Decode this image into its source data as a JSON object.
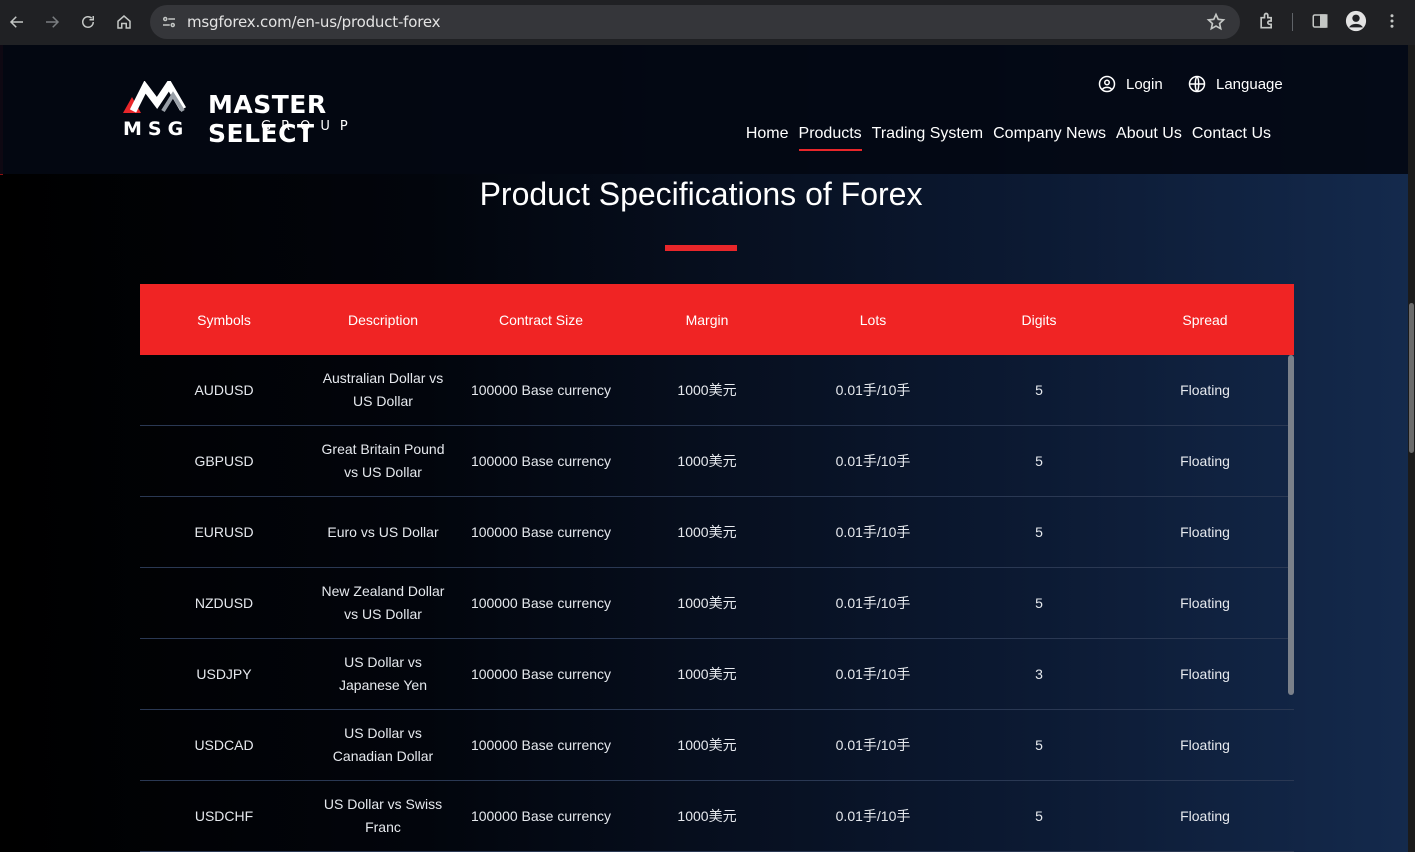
{
  "browser": {
    "url": "msgforex.com/en-us/product-forex"
  },
  "header": {
    "brand": "MASTER SELECT",
    "brand_sub": "GROUP",
    "brand_short": "MSG",
    "login_label": "Login",
    "language_label": "Language",
    "nav": [
      "Home",
      "Products",
      "Trading System",
      "Company News",
      "About Us",
      "Contact Us"
    ],
    "active_nav": "Products",
    "accent_color": "#e8262a"
  },
  "page": {
    "title": "Product Specifications of Forex"
  },
  "table": {
    "headers": [
      "Symbols",
      "Description",
      "Contract Size",
      "Margin",
      "Lots",
      "Digits",
      "Spread"
    ],
    "rows": [
      [
        "AUDUSD",
        "Australian Dollar vs US Dollar",
        "100000 Base currency",
        "1000美元",
        "0.01手/10手",
        "5",
        "Floating"
      ],
      [
        "GBPUSD",
        "Great Britain Pound vs US Dollar",
        "100000 Base currency",
        "1000美元",
        "0.01手/10手",
        "5",
        "Floating"
      ],
      [
        "EURUSD",
        "Euro vs US Dollar",
        "100000 Base currency",
        "1000美元",
        "0.01手/10手",
        "5",
        "Floating"
      ],
      [
        "NZDUSD",
        "New Zealand Dollar vs US Dollar",
        "100000 Base currency",
        "1000美元",
        "0.01手/10手",
        "5",
        "Floating"
      ],
      [
        "USDJPY",
        "US Dollar vs Japanese Yen",
        "100000 Base currency",
        "1000美元",
        "0.01手/10手",
        "3",
        "Floating"
      ],
      [
        "USDCAD",
        "US Dollar vs Canadian Dollar",
        "100000 Base currency",
        "1000美元",
        "0.01手/10手",
        "5",
        "Floating"
      ],
      [
        "USDCHF",
        "US Dollar vs Swiss Franc",
        "100000 Base currency",
        "1000美元",
        "0.01手/10手",
        "5",
        "Floating"
      ]
    ]
  }
}
